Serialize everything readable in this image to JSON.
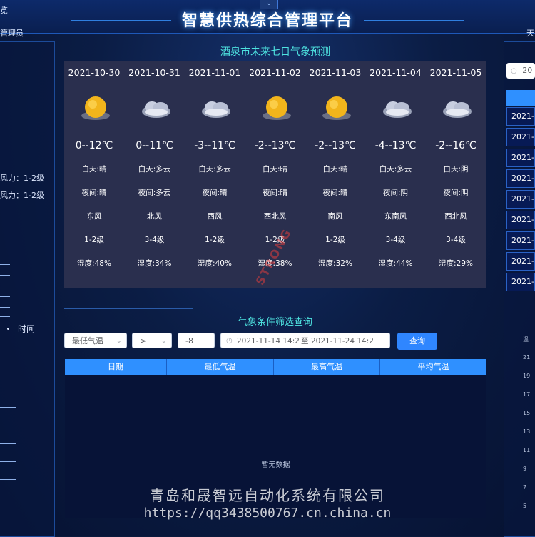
{
  "header": {
    "title": "智慧供热综合管理平台",
    "collapse_icon": "chevron-down-icon",
    "left_top_label": "览",
    "left_admin_label": "管理员",
    "right_top_label": "天"
  },
  "left_panel": {
    "wind_lines": [
      "风力：1-2级",
      "风力：1-2级"
    ],
    "time_label": "时间"
  },
  "forecast": {
    "title": "酒泉市未来七日气象预测",
    "days": [
      {
        "date": "2021-10-30",
        "icon": "sun-icon",
        "temp": "0--12℃",
        "day": "白天:晴",
        "night": "夜间:晴",
        "wind_dir": "东风",
        "wind_level": "1-2级",
        "humidity": "湿度:48%"
      },
      {
        "date": "2021-10-31",
        "icon": "cloud-icon",
        "temp": "0--11℃",
        "day": "白天:多云",
        "night": "夜间:多云",
        "wind_dir": "北风",
        "wind_level": "3-4级",
        "humidity": "湿度:34%"
      },
      {
        "date": "2021-11-01",
        "icon": "cloud-icon",
        "temp": "-3--11℃",
        "day": "白天:多云",
        "night": "夜间:晴",
        "wind_dir": "西风",
        "wind_level": "1-2级",
        "humidity": "湿度:40%"
      },
      {
        "date": "2021-11-02",
        "icon": "sun-icon",
        "temp": "-2--13℃",
        "day": "白天:晴",
        "night": "夜间:晴",
        "wind_dir": "西北风",
        "wind_level": "1-2级",
        "humidity": "湿度:38%"
      },
      {
        "date": "2021-11-03",
        "icon": "sun-icon",
        "temp": "-2--13℃",
        "day": "白天:晴",
        "night": "夜间:晴",
        "wind_dir": "南风",
        "wind_level": "1-2级",
        "humidity": "湿度:32%"
      },
      {
        "date": "2021-11-04",
        "icon": "cloud-icon",
        "temp": "-4--13℃",
        "day": "白天:多云",
        "night": "夜间:阴",
        "wind_dir": "东南风",
        "wind_level": "3-4级",
        "humidity": "湿度:44%"
      },
      {
        "date": "2021-11-05",
        "icon": "cloud-icon",
        "temp": "-2--16℃",
        "day": "白天:阴",
        "night": "夜间:阴",
        "wind_dir": "西北风",
        "wind_level": "3-4级",
        "humidity": "湿度:29%"
      }
    ]
  },
  "watermark": "STRONG",
  "filter": {
    "title": "气象条件筛选查询",
    "field_select": "最低气温",
    "operator_select": ">",
    "value_input": "-8",
    "date_start": "2021-11-14 14:2",
    "date_separator": "至",
    "date_end": "2021-11-24 14:2",
    "query_button": "查询",
    "columns": [
      "日期",
      "最低气温",
      "最高气温",
      "平均气温"
    ],
    "empty_text": "暂无数据"
  },
  "right_panel": {
    "date_input": "20",
    "rows": [
      "2021-",
      "2021-",
      "2021-",
      "2021-",
      "2021-",
      "2021-",
      "2021-",
      "2021-",
      "2021-"
    ],
    "axis_labels": [
      "温",
      "21",
      "19",
      "17",
      "15",
      "13",
      "11",
      "9",
      "7",
      "5"
    ]
  },
  "footer": {
    "company": "青岛和晟智远自动化系统有限公司",
    "url": "https://qq3438500767.cn.china.cn"
  },
  "colors": {
    "accent": "#2f90ff",
    "title_cyan": "#4ee3e0",
    "panel": "#2a2f4e"
  }
}
